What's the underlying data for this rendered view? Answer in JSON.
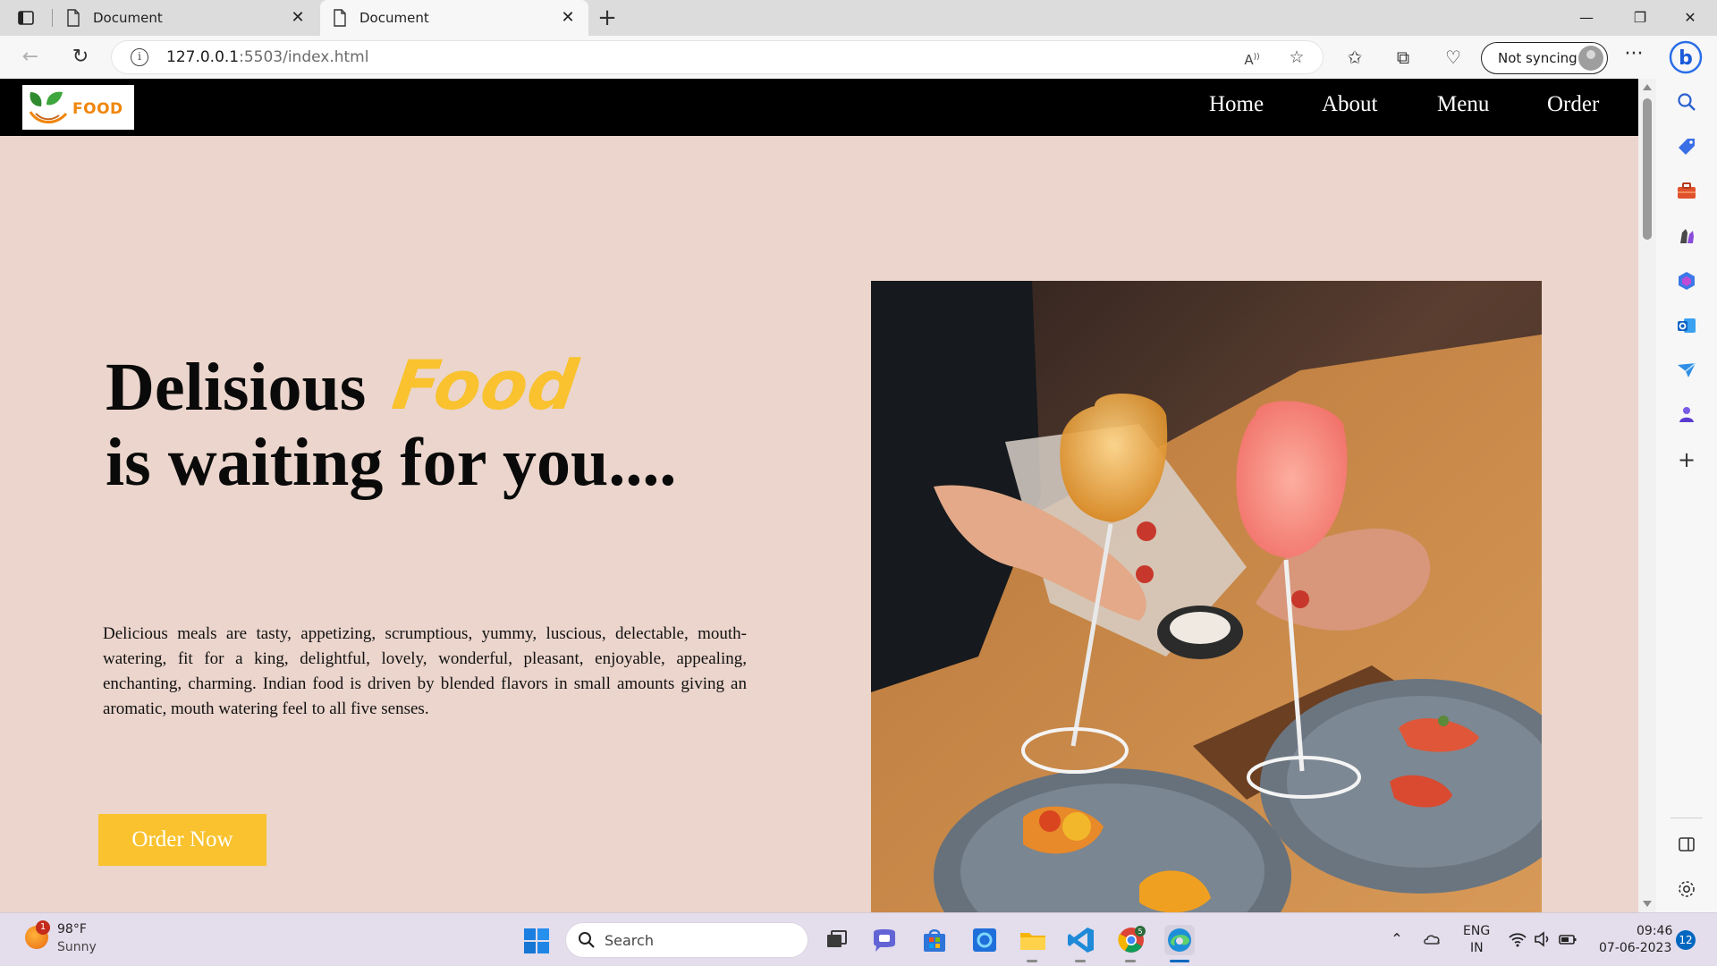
{
  "browser": {
    "tabs": [
      {
        "title": "Document"
      },
      {
        "title": "Document"
      }
    ],
    "address": {
      "host": "127.0.0.1",
      "rest": ":5503/index.html"
    },
    "sync_label": "Not syncing"
  },
  "site": {
    "logo_text": "FOOD",
    "nav": [
      "Home",
      "About",
      "Menu",
      "Order"
    ],
    "hero": {
      "line1": "Delisious",
      "accent": "Food",
      "line2": "is waiting for you....",
      "paragraph": "Delicious meals are tasty, appetizing, scrumptious, yummy, luscious, delectable, mouth-watering, fit for a king, delightful, lovely, wonderful, pleasant, enjoyable, appealing, enchanting, charming. Indian food is driven by blended flavors in small amounts giving an aromatic, mouth watering feel to all five senses.",
      "cta": "Order Now"
    },
    "colors": {
      "accent": "#f9c22e",
      "background": "#ebd5cc",
      "nav": "#000000"
    }
  },
  "taskbar": {
    "weather": {
      "badge": "1",
      "temp": "98°F",
      "desc": "Sunny"
    },
    "search_placeholder": "Search",
    "chrome_badge": "5",
    "lang": {
      "line1": "ENG",
      "line2": "IN"
    },
    "clock": {
      "time": "09:46",
      "date": "07-06-2023"
    },
    "notifications": "12"
  }
}
